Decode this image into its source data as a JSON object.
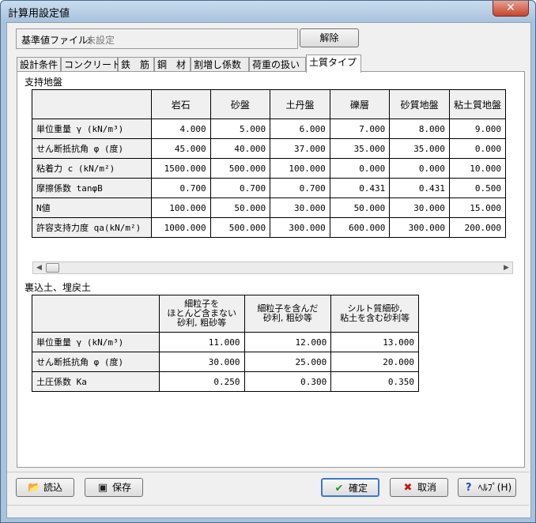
{
  "window": {
    "title": "計算用設定値",
    "close_glyph": "✕"
  },
  "file": {
    "label": "基準値ファイル:",
    "value": "未設定"
  },
  "release_button": "解除",
  "tabs": [
    "設計条件",
    "コンクリート",
    "鉄　筋",
    "鋼　材",
    "割増し係数",
    "荷重の扱い",
    "土質タイプ"
  ],
  "active_tab": 6,
  "support_ground": {
    "title": "支持地盤",
    "columns": [
      "岩石",
      "砂盤",
      "土丹盤",
      "礫層",
      "砂質地盤",
      "粘土質地盤"
    ],
    "rows": [
      {
        "label": "単位重量 γ      (kN/m³)",
        "values": [
          "4.000",
          "5.000",
          "6.000",
          "7.000",
          "8.000",
          "9.000"
        ]
      },
      {
        "label": "せん断抵抗角 φ     (度)",
        "values": [
          "45.000",
          "40.000",
          "37.000",
          "35.000",
          "35.000",
          "0.000"
        ]
      },
      {
        "label": "粘着力 c       (kN/m²)",
        "values": [
          "1500.000",
          "500.000",
          "100.000",
          "0.000",
          "0.000",
          "10.000"
        ]
      },
      {
        "label": "摩擦係数 tanφB",
        "values": [
          "0.700",
          "0.700",
          "0.700",
          "0.431",
          "0.431",
          "0.500"
        ]
      },
      {
        "label": "N値",
        "values": [
          "100.000",
          "50.000",
          "30.000",
          "50.000",
          "30.000",
          "15.000"
        ]
      },
      {
        "label": "許容支持力度 qa(kN/m²)",
        "values": [
          "1000.000",
          "500.000",
          "300.000",
          "600.000",
          "300.000",
          "200.000"
        ]
      }
    ]
  },
  "backfill": {
    "title": "裏込土、埋戻土",
    "columns": [
      "細粒子を\nほとんど含まない\n砂利, 粗砂等",
      "細粒子を含んだ\n砂利, 粗砂等",
      "シルト質細砂,\n粘土を含む砂利等"
    ],
    "rows": [
      {
        "label": "単位重量 γ    (kN/m³)",
        "values": [
          "11.000",
          "12.000",
          "13.000"
        ]
      },
      {
        "label": "せん断抵抗角 φ    (度)",
        "values": [
          "30.000",
          "25.000",
          "20.000"
        ]
      },
      {
        "label": "土圧係数 Ka",
        "values": [
          "0.250",
          "0.300",
          "0.350"
        ]
      }
    ]
  },
  "buttons": {
    "load": "読込",
    "save": "保存",
    "ok": "確定",
    "cancel": "取消",
    "help": "ﾍﾙﾌﾟ(H)"
  }
}
